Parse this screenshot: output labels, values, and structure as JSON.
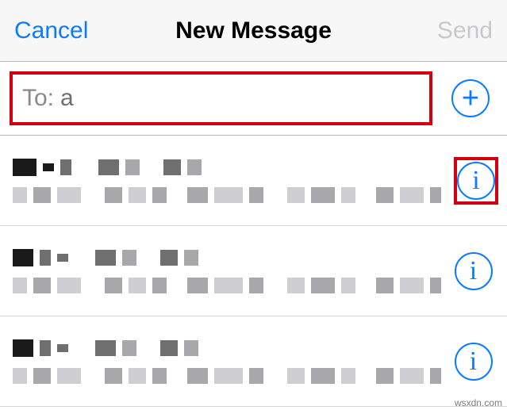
{
  "nav": {
    "cancel": "Cancel",
    "title": "New Message",
    "send": "Send"
  },
  "compose": {
    "to_label": "To:",
    "to_value": "a"
  },
  "icons": {
    "plus": "+",
    "info": "i"
  },
  "suggestions": [
    {
      "highlight_info": true
    },
    {
      "highlight_info": false
    },
    {
      "highlight_info": false
    }
  ],
  "watermark": "wsxdn.com",
  "colors": {
    "accent": "#0a7cff",
    "highlight_border": "#d3000f",
    "disabled": "#c9c9cc"
  }
}
